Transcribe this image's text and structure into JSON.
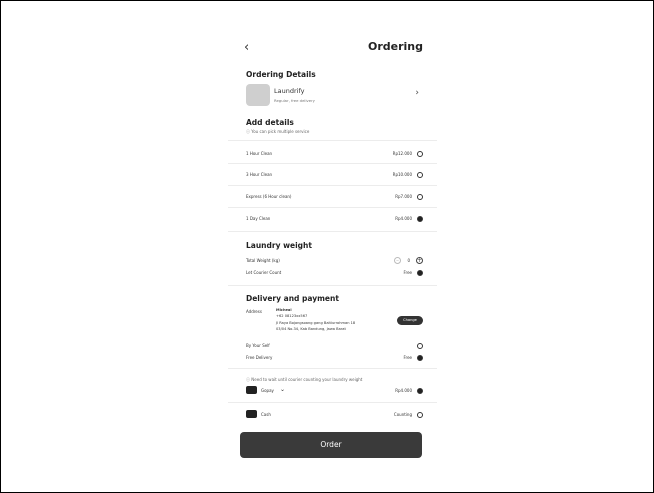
{
  "header": {
    "back_icon": "chevron-left-icon",
    "title": "Ordering"
  },
  "details": {
    "heading": "Ordering Details",
    "shop_name": "Laundrify",
    "shop_sub": "Regular, free delivery"
  },
  "add_details": {
    "heading": "Add details",
    "hint": "You can pick multiple service",
    "services": [
      {
        "label": "1 Hour Clean",
        "price": "Rp12.000",
        "selected": false
      },
      {
        "label": "3 Hour Clean",
        "price": "Rp10.000",
        "selected": false
      },
      {
        "label": "Express (6 Hour clean)",
        "price": "Rp7.000",
        "selected": false
      },
      {
        "label": "1 Day Clean",
        "price": "Rp4.000",
        "selected": true
      }
    ]
  },
  "weight": {
    "heading": "Laundry weight",
    "total_label": "Total Weight (kg)",
    "total_value": "0",
    "courier_label": "Let Courier Count",
    "courier_price": "Free"
  },
  "delivery": {
    "heading": "Delivery and payment",
    "address_label": "Address",
    "name": "Micheal",
    "phone": "+62 08123xx567",
    "address_line1": "Jl Raya Bojongsoang gang Baitiurrohman 18",
    "address_line2": "03/04 No.34, Kab Bandung, Jawa Barat",
    "change_label": "Change",
    "by_self": "By Your Self",
    "free_delivery": "Free Delivery",
    "free_delivery_price": "Free",
    "note": "Need to wait until courier counting your laundry weight",
    "wallet_name": "Gopay",
    "wallet_amount": "Rp4.000",
    "cash_label": "Cash",
    "cash_value": "Counting"
  },
  "order_label": "Order"
}
